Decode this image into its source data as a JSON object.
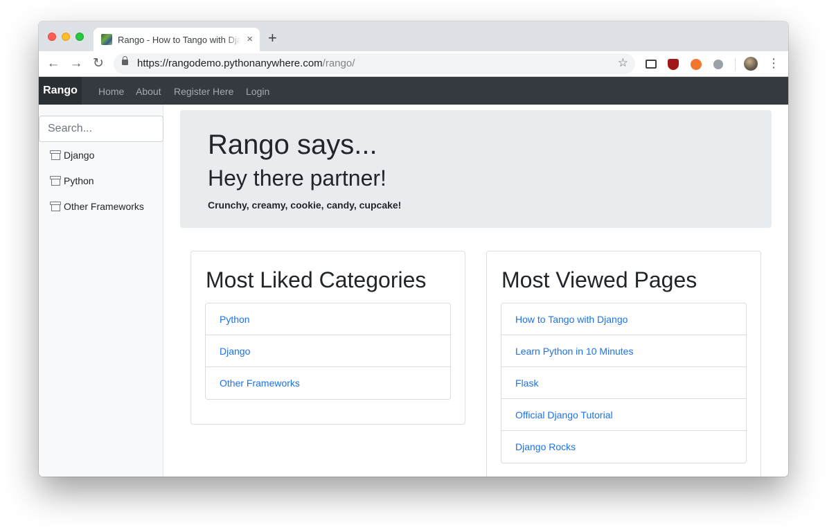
{
  "browser": {
    "tab_title": "Rango - How to Tango with Django",
    "tab_close": "×",
    "new_tab": "+",
    "url_host": "https://rangodemo.pythonanywhere.com",
    "url_path": "/rango/",
    "back": "←",
    "forward": "→",
    "reload": "↻",
    "star": "☆",
    "menu": "⋮"
  },
  "navbar": {
    "brand": "Rango",
    "links": [
      "Home",
      "About",
      "Register Here",
      "Login"
    ]
  },
  "sidebar": {
    "search_placeholder": "Search...",
    "items": [
      "Django",
      "Python",
      "Other Frameworks"
    ]
  },
  "jumbotron": {
    "title": "Rango says...",
    "subtitle": "Hey there partner!",
    "tagline": "Crunchy, creamy, cookie, candy, cupcake!"
  },
  "liked": {
    "heading": "Most Liked Categories",
    "items": [
      "Python",
      "Django",
      "Other Frameworks"
    ]
  },
  "viewed": {
    "heading": "Most Viewed Pages",
    "items": [
      "How to Tango with Django",
      "Learn Python in 10 Minutes",
      "Flask",
      "Official Django Tutorial",
      "Django Rocks"
    ]
  },
  "colors": {
    "navbar_bg": "#343a40",
    "link": "#1a73e8",
    "jumbotron_bg": "#e9ecef"
  }
}
